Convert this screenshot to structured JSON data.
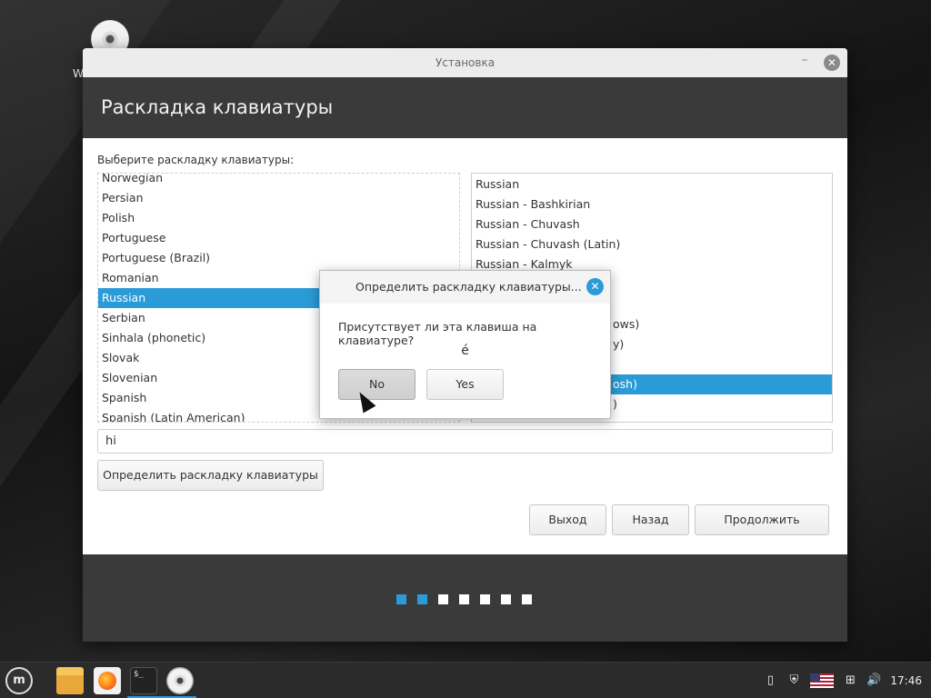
{
  "desktop": {
    "icon_label": "W"
  },
  "window": {
    "title": "Установка",
    "header": "Раскладка клавиатуры"
  },
  "layout_page": {
    "prompt": "Выберите раскладку клавиатуры:",
    "left_list": [
      "Norwegian",
      "Persian",
      "Polish",
      "Portuguese",
      "Portuguese (Brazil)",
      "Romanian",
      "Russian",
      "Serbian",
      "Sinhala (phonetic)",
      "Slovak",
      "Slovenian",
      "Spanish",
      "Spanish (Latin American)"
    ],
    "left_selected": "Russian",
    "right_list": [
      "Russian",
      "Russian - Bashkirian",
      "Russian - Chuvash",
      "Russian - Chuvash (Latin)",
      "Russian - Kalmyk",
      "",
      "",
      "",
      "",
      "",
      "",
      "",
      ""
    ],
    "right_partial": {
      "item7": "ows)",
      "item8": "y)",
      "item10": "osh)",
      "item11": ")"
    },
    "test_input_value": "hi",
    "detect_button": "Определить раскладку клавиатуры",
    "quit_button": "Выход",
    "back_button": "Назад",
    "continue_button": "Продолжить"
  },
  "progress": {
    "total_steps": 7,
    "current_step": 2
  },
  "dialog": {
    "title": "Определить раскладку клавиатуры...",
    "question": "Присутствует ли эта клавиша на клавиатуре?",
    "key": "é",
    "no_button": "No",
    "yes_button": "Yes"
  },
  "taskbar": {
    "clock": "17:46",
    "terminal_glyph": "$_",
    "mint_glyph": "m"
  },
  "colors": {
    "accent": "#2a9bd7",
    "header_bg": "#3a3a3a"
  }
}
